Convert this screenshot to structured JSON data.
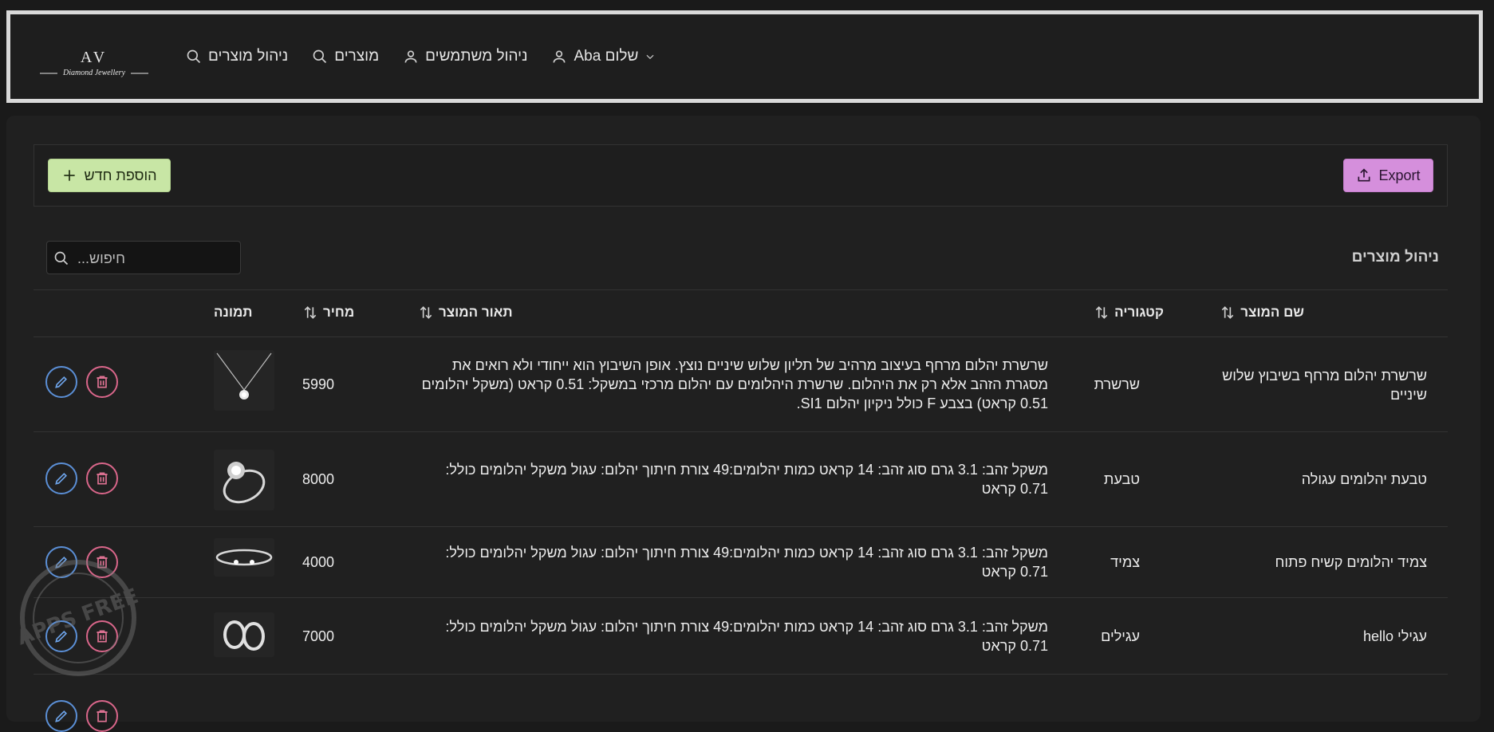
{
  "nav": {
    "logo_text": "AV",
    "logo_sub": "Diamond Jewellery",
    "items": [
      {
        "label": "ניהול מוצרים",
        "icon": "search-icon"
      },
      {
        "label": "מוצרים",
        "icon": "search-icon"
      },
      {
        "label": "ניהול משתמשים",
        "icon": "user-icon"
      },
      {
        "label": "שלום Aba",
        "icon": "user-icon"
      }
    ]
  },
  "toolbar": {
    "add_label": "הוספת חדש",
    "export_label": "Export"
  },
  "search": {
    "placeholder": "חיפוש..."
  },
  "section_title": "ניהול מוצרים",
  "table": {
    "headers": {
      "name": "שם המוצר",
      "category": "קטגוריה",
      "description": "תאור המוצר",
      "price": "מחיר",
      "image": "תמונה"
    },
    "rows": [
      {
        "name": "שרשרת יהלום מרחף בשיבוץ שלוש שיניים",
        "category": "שרשרת",
        "description": "שרשרת יהלום מרחף בעיצוב מרהיב של תליון שלוש שיניים נוצץ. אופן השיבוץ הוא ייחודי ולא רואים את מסגרת הזהב אלא רק את היהלום. שרשרת היהלומים עם יהלום מרכזי במשקל: 0.51 קראט (משקל יהלומים 0.51 קראט) בצבע F כולל ניקיון יהלום SI1.",
        "price": "5990",
        "image": "necklace"
      },
      {
        "name": "טבעת יהלומים עגולה",
        "category": "טבעת",
        "description": "משקל זהב: 3.1 גרם סוג זהב: 14 קראט כמות יהלומים:49 צורת חיתוך יהלום: עגול משקל יהלומים כולל: 0.71 קראט",
        "price": "8000",
        "image": "ring"
      },
      {
        "name": "צמיד יהלומים קשיח פתוח",
        "category": "צמיד",
        "description": "משקל זהב: 3.1 גרם סוג זהב: 14 קראט כמות יהלומים:49 צורת חיתוך יהלום: עגול משקל יהלומים כולל: 0.71 קראט",
        "price": "4000",
        "image": "bracelet"
      },
      {
        "name": "עגילי hello",
        "category": "עגילים",
        "description": "משקל זהב: 3.1 גרם סוג זהב: 14 קראט כמות יהלומים:49 צורת חיתוך יהלום: עגול משקל יהלומים כולל: 0.71 קראט",
        "price": "7000",
        "image": "earrings"
      }
    ]
  },
  "watermark_text": "מחשב APPS FREE חינמי"
}
